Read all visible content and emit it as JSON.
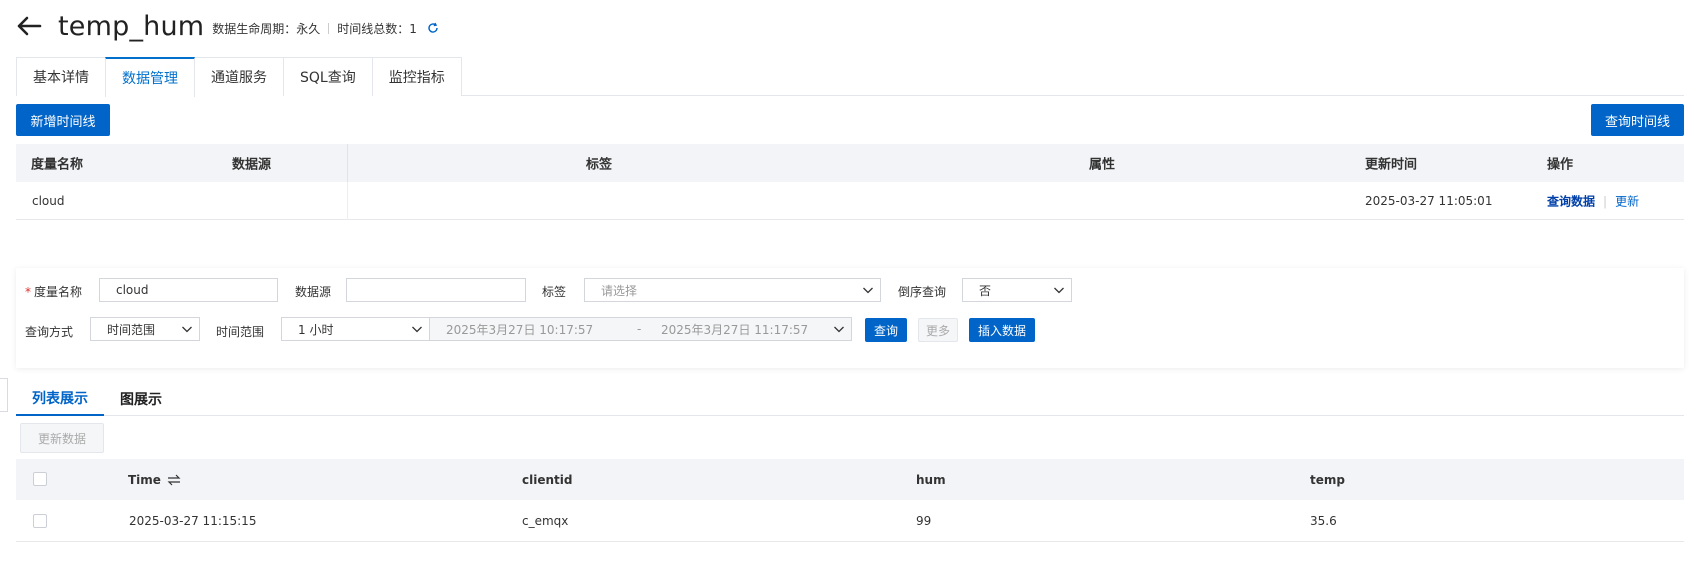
{
  "header": {
    "title": "temp_hum",
    "lifecycle_label": "数据生命周期：永久",
    "timeline_count_label": "时间线总数：1"
  },
  "tabs": [
    {
      "label": "基本详情"
    },
    {
      "label": "数据管理"
    },
    {
      "label": "通道服务"
    },
    {
      "label": "SQL查询"
    },
    {
      "label": "监控指标"
    }
  ],
  "toolbar": {
    "add_timeline": "新增时间线",
    "query_timeline": "查询时间线"
  },
  "timeline_table": {
    "columns": [
      "度量名称",
      "数据源",
      "标签",
      "属性",
      "更新时间",
      "操作"
    ],
    "rows": [
      {
        "measure": "cloud",
        "source": "",
        "tags": "",
        "attrs": "",
        "updated": "2025-03-27 11:05:01",
        "action_query": "查询数据",
        "action_update": "更新"
      }
    ]
  },
  "query": {
    "measure_label": "度量名称",
    "measure_value": "cloud",
    "source_label": "数据源",
    "source_value": "",
    "tags_label": "标签",
    "tags_placeholder": "请选择",
    "reverse_label": "倒序查询",
    "reverse_value": "否",
    "mode_label": "查询方式",
    "mode_value": "时间范围",
    "range_label": "时间范围",
    "range_value": "1 小时",
    "start_time": "2025年3月27日 10:17:57",
    "range_sep": "-",
    "end_time": "2025年3月27日 11:17:57",
    "query_btn": "查询",
    "more_btn": "更多",
    "insert_btn": "插入数据"
  },
  "view_tabs": [
    {
      "label": "列表展示"
    },
    {
      "label": "图展示"
    }
  ],
  "refresh_data_btn": "更新数据",
  "data_table": {
    "columns": [
      "Time",
      "clientid",
      "hum",
      "temp"
    ],
    "rows": [
      {
        "time": "2025-03-27 11:15:15",
        "clientid": "c_emqx",
        "hum": "99",
        "temp": "35.6"
      }
    ]
  },
  "colors": {
    "primary": "#0064c8",
    "required": "#e0312d"
  }
}
